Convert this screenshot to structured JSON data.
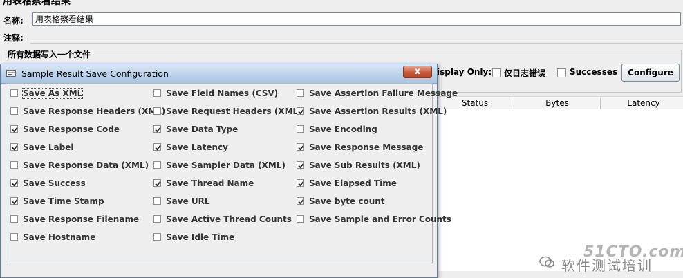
{
  "background": {
    "title": "用表格察看结果",
    "name_label": "名称:",
    "name_value": "用表格察看结果",
    "comment_label": "注释:",
    "file_group_title": "所有数据写入一个文件",
    "display_only_label": "isplay Only:",
    "errors_label": "仅日志错误",
    "successes_label": "Successes",
    "configure_button": "Configure",
    "table_columns": [
      "Status",
      "Bytes",
      "Latency"
    ]
  },
  "dialog": {
    "title": "Sample Result Save Configuration",
    "close_symbol": "x",
    "options": [
      {
        "label": "Save As XML",
        "checked": false
      },
      {
        "label": "Save Field Names (CSV)",
        "checked": false
      },
      {
        "label": "Save Assertion Failure Message",
        "checked": false
      },
      {
        "label": "Save Response Headers (XML)",
        "checked": false
      },
      {
        "label": "Save Request Headers (XML)",
        "checked": false
      },
      {
        "label": "Save Assertion Results (XML)",
        "checked": true
      },
      {
        "label": "Save Response Code",
        "checked": true
      },
      {
        "label": "Save Data Type",
        "checked": true
      },
      {
        "label": "Save Encoding",
        "checked": false
      },
      {
        "label": "Save Label",
        "checked": true
      },
      {
        "label": "Save Latency",
        "checked": true
      },
      {
        "label": "Save Response Message",
        "checked": true
      },
      {
        "label": "Save Response Data (XML)",
        "checked": false
      },
      {
        "label": "Save Sampler Data (XML)",
        "checked": false
      },
      {
        "label": "Save Sub Results (XML)",
        "checked": true
      },
      {
        "label": "Save Success",
        "checked": true
      },
      {
        "label": "Save Thread Name",
        "checked": true
      },
      {
        "label": "Save Elapsed Time",
        "checked": true
      },
      {
        "label": "Save Time Stamp",
        "checked": true
      },
      {
        "label": "Save URL",
        "checked": false
      },
      {
        "label": "Save byte count",
        "checked": true
      },
      {
        "label": "Save Response Filename",
        "checked": false
      },
      {
        "label": "Save Active Thread Counts",
        "checked": false
      },
      {
        "label": "Save Sample and Error Counts",
        "checked": false
      },
      {
        "label": "Save Hostname",
        "checked": false
      },
      {
        "label": "Save Idle Time",
        "checked": false
      }
    ]
  },
  "watermark": {
    "logo": "51CTO.com",
    "text": "软件测试培训"
  }
}
